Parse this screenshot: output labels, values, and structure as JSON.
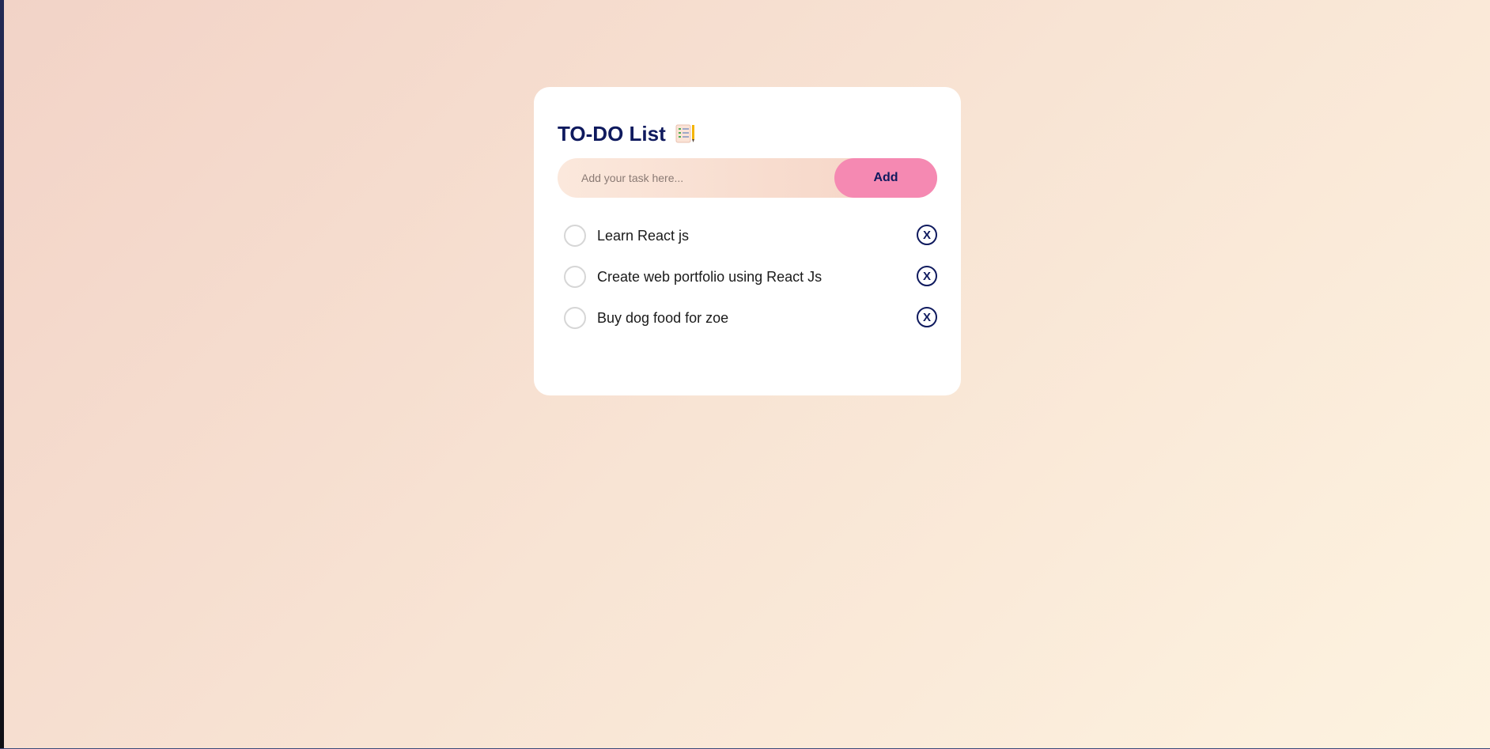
{
  "app": {
    "title": "TO-DO List",
    "title_icon": "checklist-notepad-icon"
  },
  "input": {
    "placeholder": "Add your task here...",
    "value": ""
  },
  "buttons": {
    "add_label": "Add",
    "remove_label": "X"
  },
  "tasks": [
    {
      "text": "Learn React js",
      "checked": false
    },
    {
      "text": "Create web portfolio using React Js",
      "checked": false
    },
    {
      "text": "Buy dog food for zoe",
      "checked": false
    }
  ],
  "colors": {
    "accent_pink": "#f589b2",
    "navy": "#0f1a5e",
    "card_bg": "#ffffff",
    "page_gradient_start": "#f2d3c7",
    "page_gradient_end": "#fdf3e0"
  }
}
